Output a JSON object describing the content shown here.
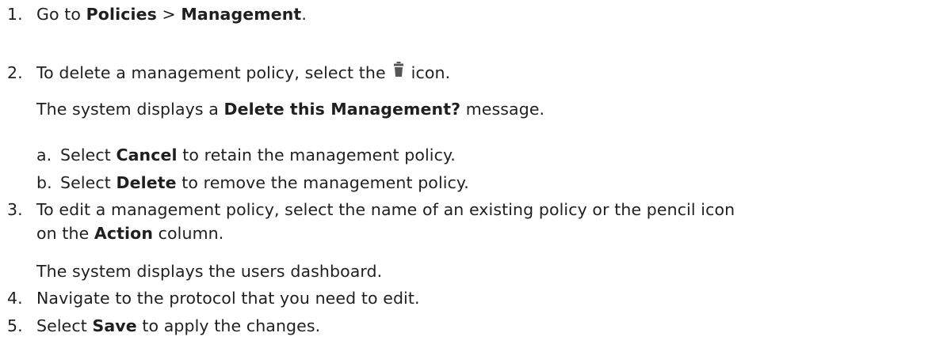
{
  "steps": [
    {
      "number": "1.",
      "pre": "Go to ",
      "bold1": "Policies",
      "mid": " > ",
      "bold2": "Management",
      "post": "."
    },
    {
      "number": "2.",
      "pre": "To delete a management policy, select the",
      "icon": "trash-icon",
      "post": "icon.",
      "result_pre": "The system displays a ",
      "result_bold": "Delete this Management?",
      "result_post": " message.",
      "substeps": [
        {
          "letter": "a.",
          "pre": "Select ",
          "bold": "Cancel",
          "post": " to retain the management policy."
        },
        {
          "letter": "b.",
          "pre": "Select ",
          "bold": "Delete",
          "post": " to remove the management policy."
        }
      ]
    },
    {
      "number": "3.",
      "line1": "To edit a management policy, select the name of an existing policy or the pencil icon",
      "line2_pre": "on the ",
      "line2_bold": "Action",
      "line2_post": " column.",
      "result": "The system displays the users dashboard."
    },
    {
      "number": "4.",
      "text": "Navigate to the protocol that you need to edit."
    },
    {
      "number": "5.",
      "pre": "Select ",
      "bold": "Save",
      "post": " to apply the changes."
    }
  ],
  "colors": {
    "text": "#1f1f1f",
    "icon": "#555555"
  }
}
